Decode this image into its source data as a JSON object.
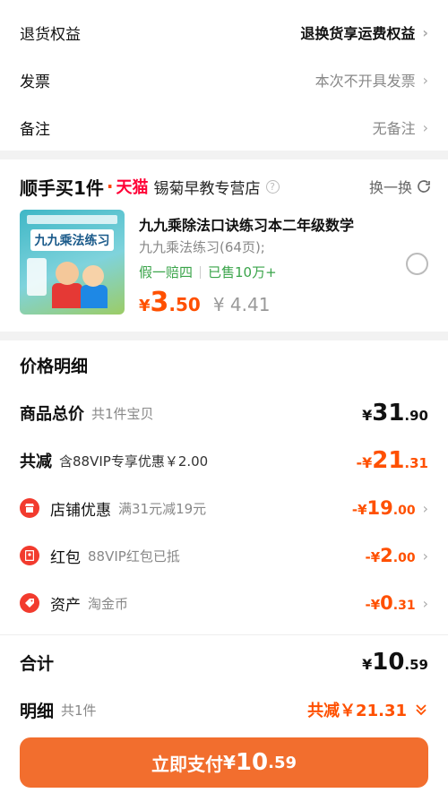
{
  "top": {
    "rows": [
      {
        "label": "退货权益",
        "value": "退换货享运费权益"
      },
      {
        "label": "发票",
        "value": "本次不开具发票"
      },
      {
        "label": "备注",
        "value": "无备注"
      }
    ]
  },
  "shop": {
    "brand": "顺手买1件",
    "brand_dot": "·",
    "tmall": "天猫",
    "name": "锡菊早教专营店",
    "help_icon": "question-icon",
    "swap_label": "换一换",
    "swap_icon": "refresh-icon",
    "product": {
      "title": "九九乘除法口诀练习本二年级数学",
      "spec": "九九乘法练习(64页);",
      "tag_guarantee": "假一赔四",
      "tag_sold": "已售10万+",
      "price_cur": "¥",
      "price_int": "3",
      "price_dec": ".50",
      "old_price": "¥ 4.41",
      "thumb_title": "九九乘法练习"
    }
  },
  "price": {
    "title": "价格明细",
    "goods": {
      "name": "商品总价",
      "sub": "共1件宝贝",
      "cur": "¥",
      "int": "31",
      "dec": ".90"
    },
    "reduce": {
      "name": "共减",
      "sub": "含88VIP专享优惠￥2.00",
      "cur": "-¥",
      "int": "21",
      "dec": ".31"
    },
    "items": [
      {
        "icon": "shop-icon",
        "name": "店铺优惠",
        "sub": "满31元减19元",
        "cur": "-¥",
        "int": "19",
        "dec": ".00"
      },
      {
        "icon": "red-packet-icon",
        "name": "红包",
        "sub": "88VIP红包已抵",
        "cur": "-¥",
        "int": "2",
        "dec": ".00"
      },
      {
        "icon": "coin-tag-icon",
        "name": "资产",
        "sub": "淘金币",
        "cur": "-¥",
        "int": "0",
        "dec": ".31"
      }
    ],
    "total": {
      "name": "合计",
      "cur": "¥",
      "int": "10",
      "dec": ".59"
    },
    "detail": {
      "name": "明细",
      "sub": "共1件",
      "right": "共减￥21.31"
    },
    "pay": {
      "label": "立即支付",
      "cur": "¥",
      "int": "10",
      "dec": ".59"
    }
  },
  "colors": {
    "accent": "#ff5000",
    "pay_button": "#f26e2e",
    "green": "#3aa44a",
    "icon_red": "#f23b2e"
  }
}
